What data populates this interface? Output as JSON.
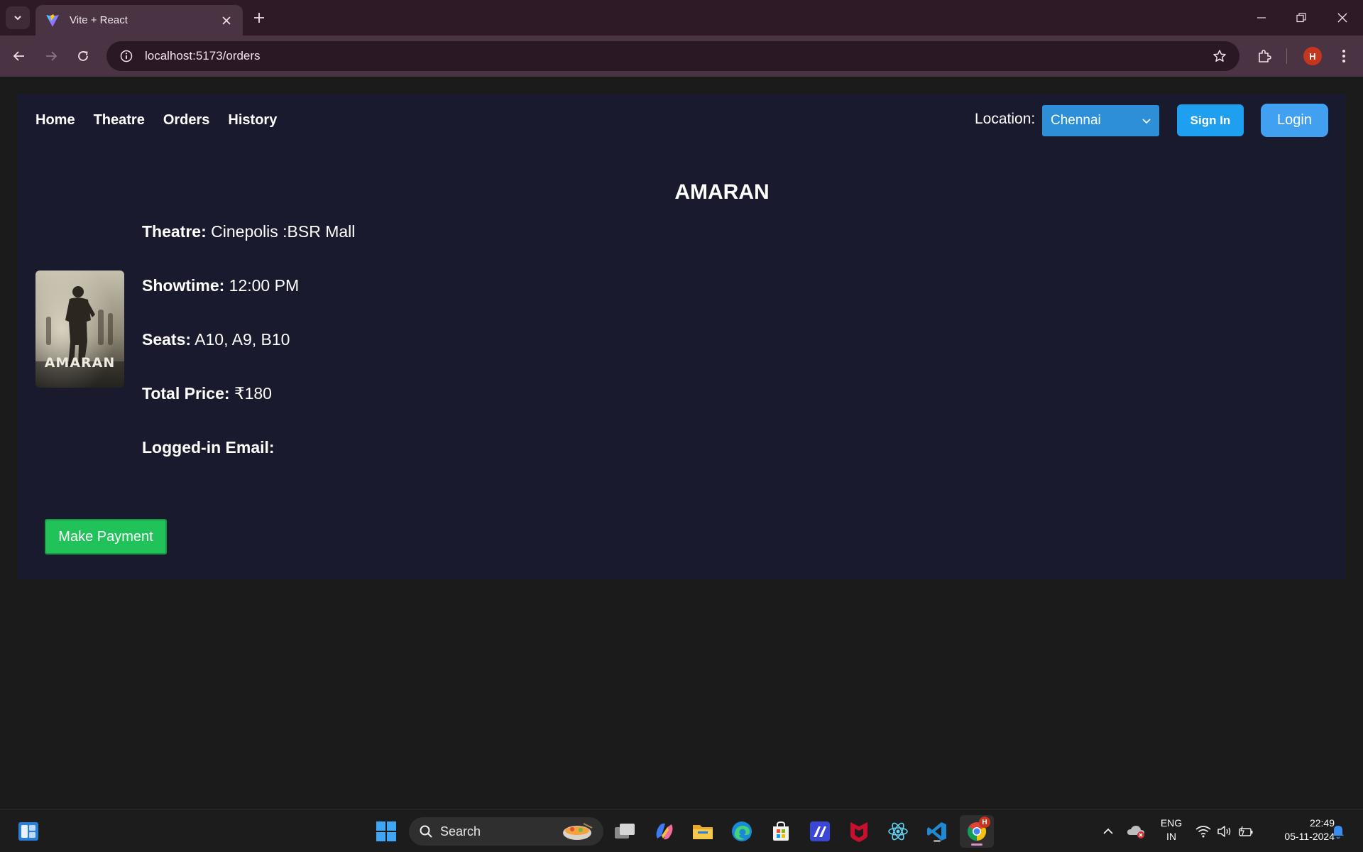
{
  "browser": {
    "tab_title": "Vite + React",
    "url": "localhost:5173/orders",
    "profile_initial": "H"
  },
  "nav": {
    "links": [
      "Home",
      "Theatre",
      "Orders",
      "History"
    ],
    "location_label": "Location:",
    "location_value": "Chennai",
    "signin_label": "Sign In",
    "login_label": "Login"
  },
  "order": {
    "movie_title": "AMARAN",
    "poster_text": "AMARAN",
    "theatre_label": "Theatre:",
    "theatre_value": "Cinepolis :BSR Mall",
    "showtime_label": "Showtime:",
    "showtime_value": "12:00 PM",
    "seats_label": "Seats:",
    "seats_value": "A10, A9, B10",
    "price_label": "Total Price:",
    "price_value": "₹180",
    "email_label": "Logged-in Email:",
    "email_value": "",
    "pay_label": "Make Payment"
  },
  "taskbar": {
    "search_label": "Search",
    "lang_line1": "ENG",
    "lang_line2": "IN",
    "time": "22:49",
    "date": "05-11-2024",
    "chrome_badge": "H"
  },
  "colors": {
    "card_bg": "#1a1a2e",
    "page_bg": "#1b1b1c",
    "pay_button": "#22c25a",
    "signin_button": "#1f9ff0",
    "login_button": "#41a1f0",
    "select_bg": "#2d8fd8"
  }
}
